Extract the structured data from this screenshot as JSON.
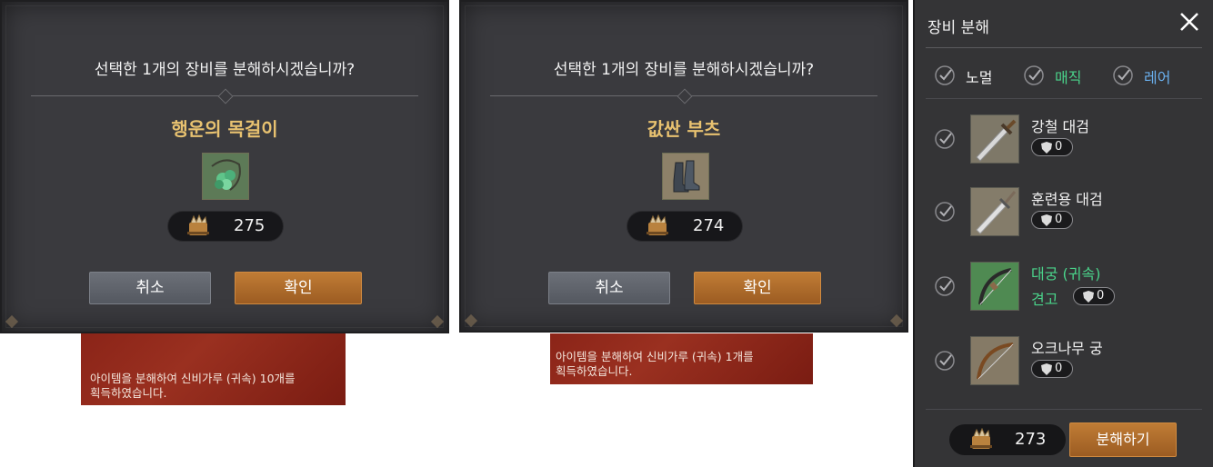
{
  "dialog1": {
    "question": "선택한 1개의 장비를 분해하시겠습니까?",
    "item_name": "행운의 목걸이",
    "cost": "275",
    "cancel_label": "취소",
    "confirm_label": "확인"
  },
  "dialog2": {
    "question": "선택한 1개의 장비를 분해하시겠습니까?",
    "item_name": "값싼 부츠",
    "cost": "274",
    "cancel_label": "취소",
    "confirm_label": "확인"
  },
  "toast1": {
    "line1": "아이템을 분해하여 신비가루 (귀속) 10개를",
    "line2": "획득하였습니다."
  },
  "toast2": {
    "line1": "아이템을 분해하여 신비가루 (귀속) 1개를",
    "line2": "획득하였습니다."
  },
  "panel": {
    "title": "장비 분해",
    "filters": [
      {
        "label": "노멀",
        "color": "#f4f4f4"
      },
      {
        "label": "매직",
        "color": "#4ad38a"
      },
      {
        "label": "레어",
        "color": "#6ab0ee"
      }
    ],
    "items": [
      {
        "name": "강철 대검",
        "enhance": "0"
      },
      {
        "name": "훈련용 대검",
        "enhance": "0"
      },
      {
        "name": "대궁 (귀속)",
        "sub": "견고",
        "enhance": "0"
      },
      {
        "name": "오크나무 궁",
        "enhance": "0"
      }
    ],
    "cost": "273",
    "disassemble_label": "분해하기"
  },
  "colors": {
    "accent_orange": "#b06c2c",
    "item_name_gold": "#e8c270",
    "magic_green": "#4ad38a",
    "rare_blue": "#6ab0ee",
    "toast_red": "#8b2418"
  }
}
